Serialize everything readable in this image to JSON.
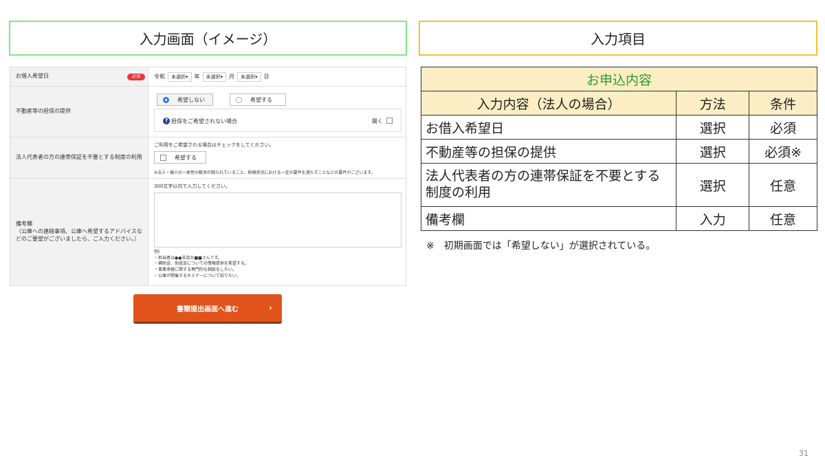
{
  "left_header": "入力画面（イメージ）",
  "right_header": "入力項目",
  "form": {
    "row1": {
      "label": "お借入希望日",
      "required_badge": "必須",
      "era": "令和",
      "year_select": "未選択▾",
      "year_unit": "年",
      "month_select": "未選択▾",
      "month_unit": "月",
      "day_select": "未選択▾",
      "day_unit": "日"
    },
    "row2": {
      "label": "不動産等の担保の提供",
      "option_no": "希望しない",
      "option_yes": "希望する",
      "collapse_text": "担保をご希望されない場合",
      "open_label": "開く"
    },
    "row3": {
      "label": "法人代表者の方の連帯保証を不要とする制度の利用",
      "instruction": "ご利用をご希望される場合はチェックをしてください。",
      "checkbox_label": "希望する",
      "note": "※法人・個人の一体性の解消が図られていること、財務状況における一定の要件を満たすことなどの要件がございます。"
    },
    "row4": {
      "label": "備考欄\n（公庫への連絡事項、公庫へ希望するアドバイスなどのご要望がございましたら、ご入力ください。）",
      "limit_text": "300文字以内で入力してください。",
      "example_title": "例)",
      "examples": [
        "・担当者は●●支店の■■さんです。",
        "・補助金、助成金についての情報提供を希望する。",
        "・事業承継に関する専門的な相談をしたい。",
        "・公庫が開催するセミナーについて知りたい。"
      ]
    },
    "submit_button": "書類提出画面へ進む",
    "submit_arrow": "›"
  },
  "table": {
    "title": "お申込内容",
    "headers": [
      "入力内容（法人の場合）",
      "方法",
      "条件"
    ],
    "rows": [
      [
        "お借入希望日",
        "選択",
        "必須"
      ],
      [
        "不動産等の担保の提供",
        "選択",
        "必須※"
      ],
      [
        "法人代表者の方の連帯保証を不要とする制度の利用",
        "選択",
        "任意"
      ],
      [
        "備考欄",
        "入力",
        "任意"
      ]
    ]
  },
  "note": "※　初期画面では「希望しない」が選択されている。",
  "page_number": "31"
}
